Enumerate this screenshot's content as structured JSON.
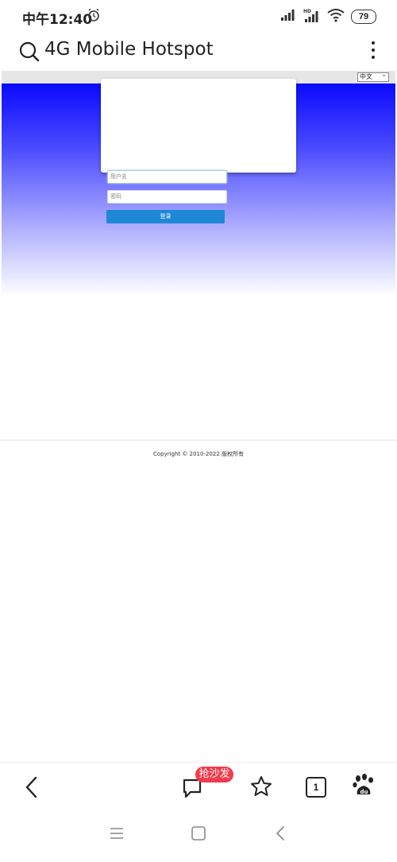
{
  "status_bar": {
    "time": "中午12:40",
    "battery": "79",
    "icons": [
      "alarm-icon",
      "signal-icon",
      "hd-signal-icon",
      "wifi-icon",
      "battery-icon"
    ]
  },
  "browser": {
    "page_title": "4G Mobile Hotspot",
    "icons": [
      "search-icon",
      "more-vert-icon"
    ]
  },
  "page": {
    "language_selected": "中文",
    "login": {
      "username_placeholder": "用户名",
      "password_placeholder": "密码",
      "login_button": "登录"
    },
    "footer": "Copyright © 2010-2022 版权所有",
    "colors": {
      "hero_top": "#0a0aff",
      "button": "#1e88d6"
    }
  },
  "toolbar": {
    "badge": "抢沙发",
    "tab_count": "1",
    "icons": [
      "back-icon",
      "comment-icon",
      "star-icon",
      "tabs-icon",
      "baidu-paw-icon"
    ],
    "badge_color": "#f23b4e"
  },
  "system_nav": {
    "icons": [
      "menu-icon",
      "home-icon",
      "back-icon"
    ]
  }
}
